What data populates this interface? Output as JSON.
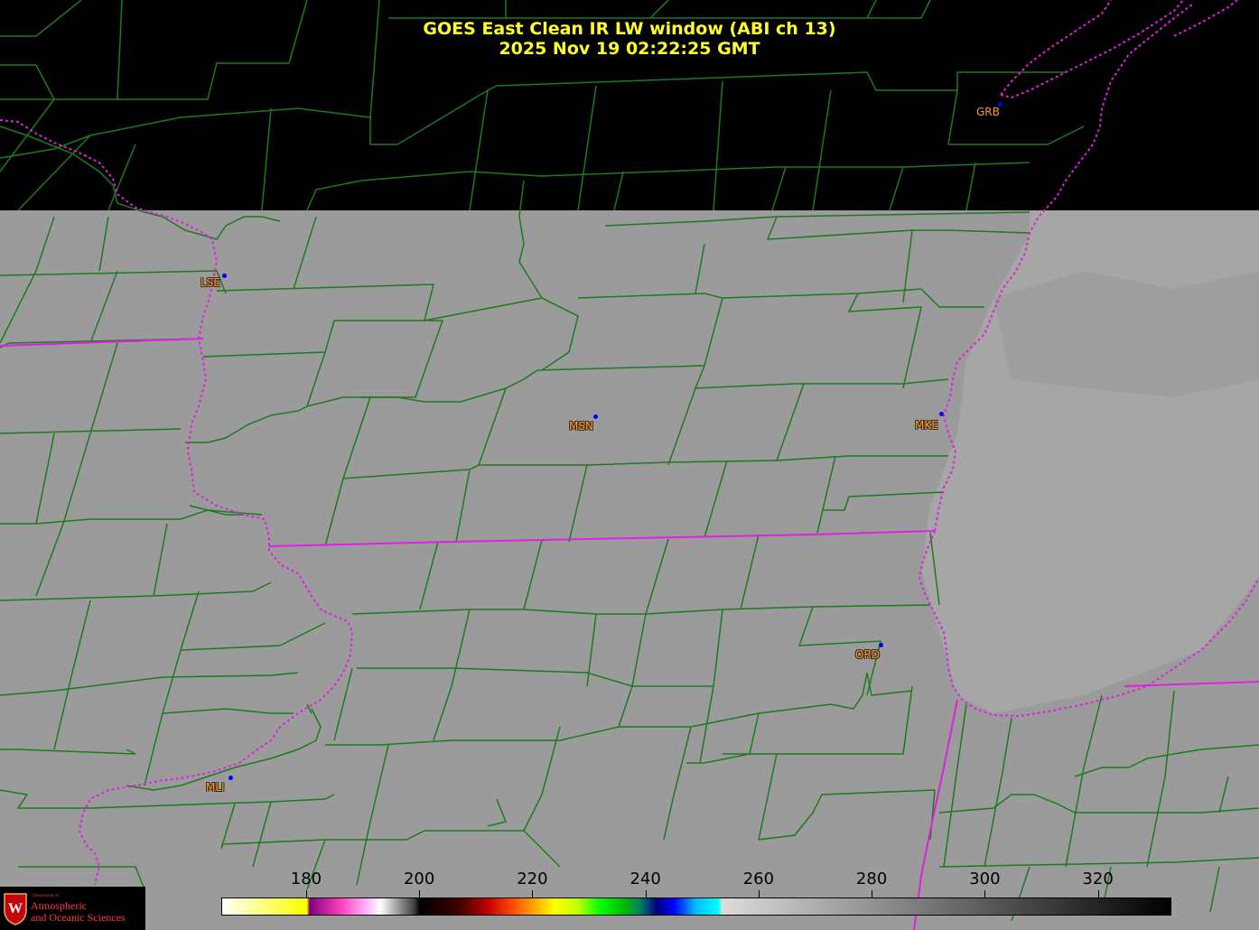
{
  "header": {
    "title": "GOES East Clean IR LW window (ABI ch 13)",
    "timestamp": "2025 Nov 19  02:22:25 GMT"
  },
  "stations": [
    {
      "id": "GRB",
      "label": "GRB",
      "region": "no-data"
    },
    {
      "id": "LSE",
      "label": "LSE",
      "region": "imagery"
    },
    {
      "id": "MSN",
      "label": "MSN",
      "region": "imagery"
    },
    {
      "id": "MKE",
      "label": "MKE",
      "region": "imagery"
    },
    {
      "id": "ORD",
      "label": "ORD",
      "region": "imagery"
    },
    {
      "id": "MLI",
      "label": "MLI",
      "region": "imagery"
    }
  ],
  "colorbar": {
    "ticks": [
      "180",
      "200",
      "220",
      "240",
      "260",
      "280",
      "300",
      "320"
    ],
    "tick_values": [
      180,
      200,
      220,
      240,
      260,
      280,
      300,
      320
    ],
    "range": [
      165,
      333
    ],
    "stops": [
      {
        "value": 165,
        "color": "#ffffff"
      },
      {
        "value": 172,
        "color": "#ffff80"
      },
      {
        "value": 180,
        "color": "#ffff00"
      },
      {
        "value": 180.5,
        "color": "#800080"
      },
      {
        "value": 186,
        "color": "#ff40c0"
      },
      {
        "value": 191,
        "color": "#ffc0ff"
      },
      {
        "value": 193,
        "color": "#ffffff"
      },
      {
        "value": 199,
        "color": "#404040"
      },
      {
        "value": 200,
        "color": "#000000"
      },
      {
        "value": 207,
        "color": "#400000"
      },
      {
        "value": 212,
        "color": "#c00000"
      },
      {
        "value": 216,
        "color": "#ff4000"
      },
      {
        "value": 220,
        "color": "#ffa000"
      },
      {
        "value": 224,
        "color": "#ffff00"
      },
      {
        "value": 228,
        "color": "#c0ff00"
      },
      {
        "value": 232,
        "color": "#00ff00"
      },
      {
        "value": 236,
        "color": "#00c000"
      },
      {
        "value": 239,
        "color": "#008060"
      },
      {
        "value": 242,
        "color": "#000080"
      },
      {
        "value": 245,
        "color": "#0000ff"
      },
      {
        "value": 249,
        "color": "#00c0ff"
      },
      {
        "value": 253,
        "color": "#00ffff"
      },
      {
        "value": 253.5,
        "color": "#dcdcdc"
      },
      {
        "value": 333,
        "color": "#000000"
      }
    ]
  },
  "logo": {
    "dept": "Department of",
    "line1": "Atmospheric",
    "line2": "and Oceanic Sciences",
    "seal_letter": "W"
  },
  "colors": {
    "county_lines": "#1e7a1e",
    "state_lines": "#e020e0",
    "title": "#ffff2a",
    "station_label": "#ff9a3c",
    "station_dot": "#0000ff",
    "imagery_gray": "#9b9b9b",
    "no_data": "#000000"
  }
}
